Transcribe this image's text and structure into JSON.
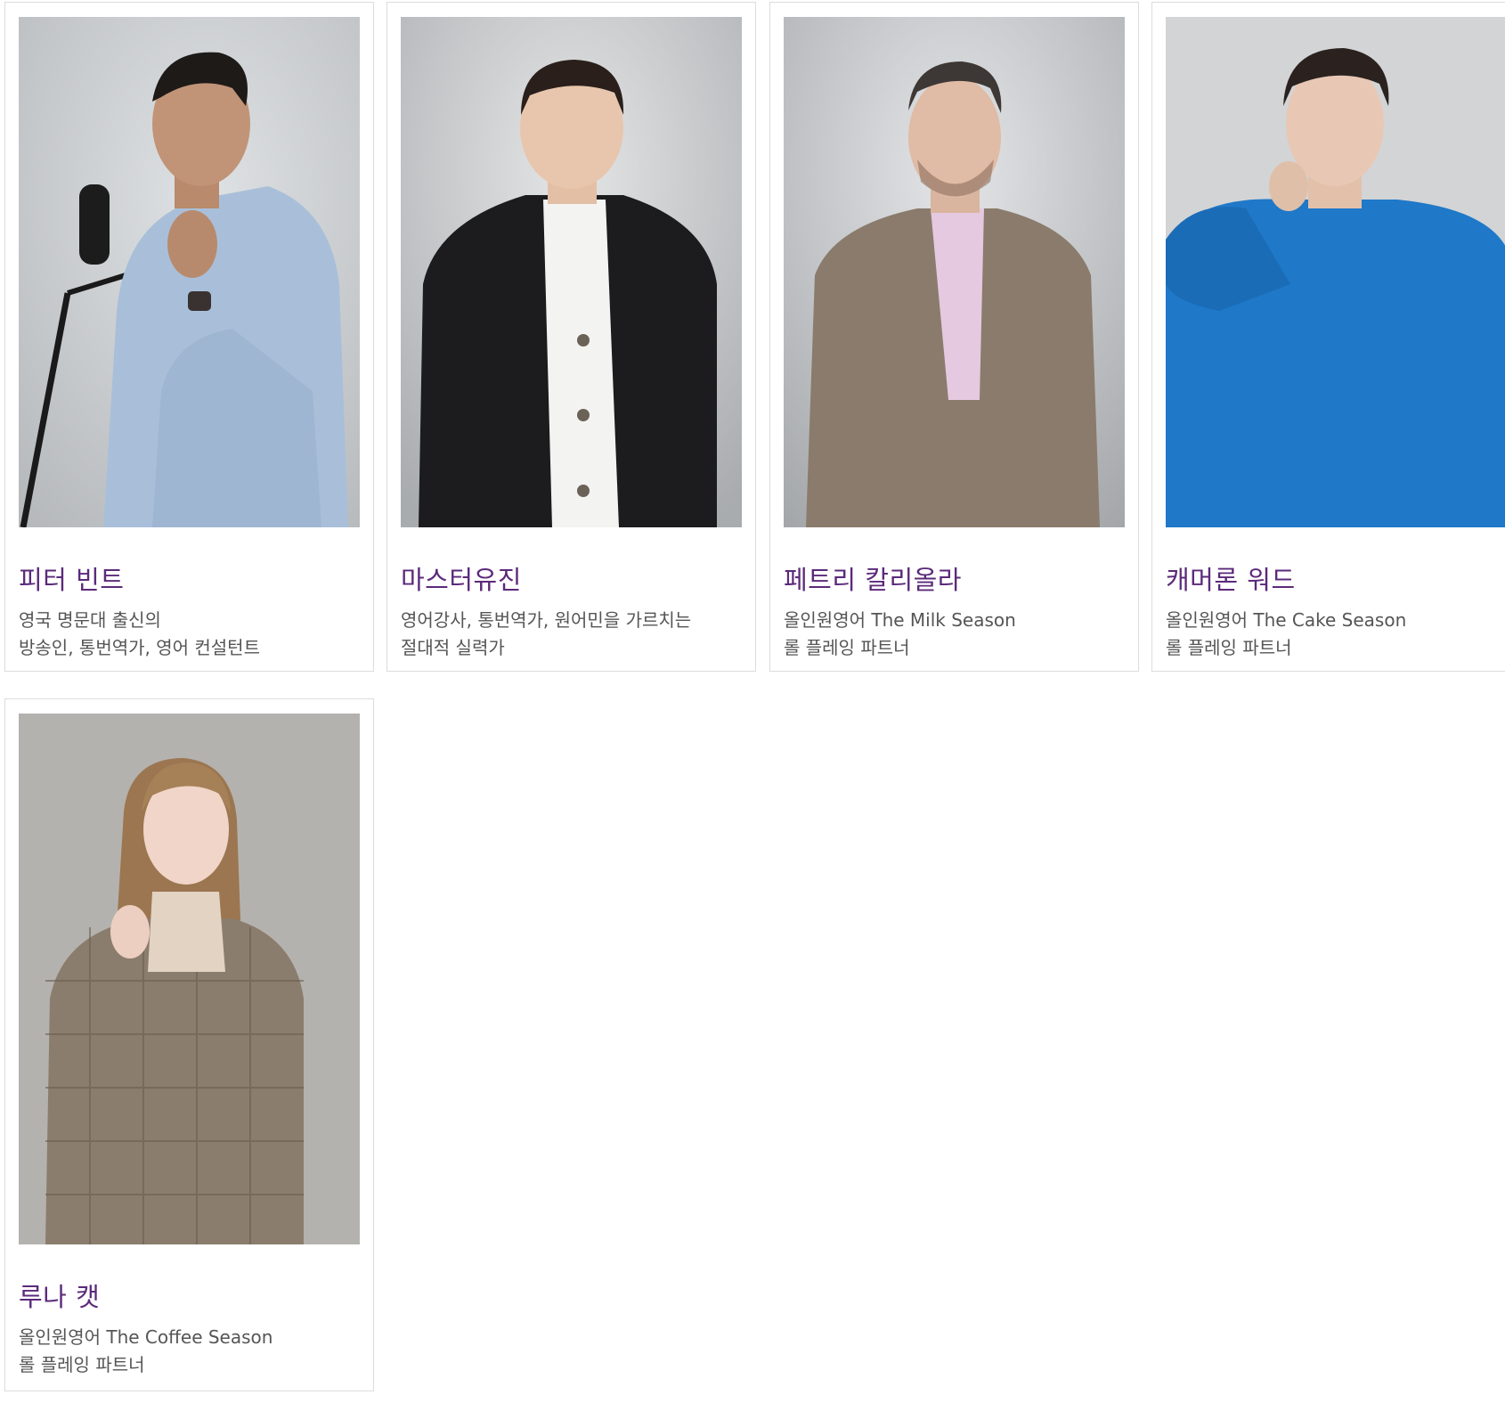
{
  "colors": {
    "name_accent": "#5b2a7a",
    "description_text": "#555555",
    "card_border": "#dcdcdc"
  },
  "partners": [
    {
      "name": "피터 빈트",
      "description_lines": [
        "영국 명문대 출신의",
        "방송인, 통번역가, 영어 컨설턴트"
      ]
    },
    {
      "name": "마스터유진",
      "description_lines": [
        "영어강사, 통번역가, 원어민을 가르치는",
        "절대적 실력가"
      ]
    },
    {
      "name": "페트리 칼리올라",
      "description_lines": [
        "올인원영어 The Milk Season",
        "롤 플레잉 파트너"
      ]
    },
    {
      "name": "캐머론 워드",
      "description_lines": [
        "올인원영어 The Cake Season",
        "롤 플레잉 파트너"
      ]
    },
    {
      "name": "루나 캣",
      "description_lines": [
        "올인원영어 The Coffee Season",
        "롤 플레잉 파트너"
      ]
    }
  ]
}
